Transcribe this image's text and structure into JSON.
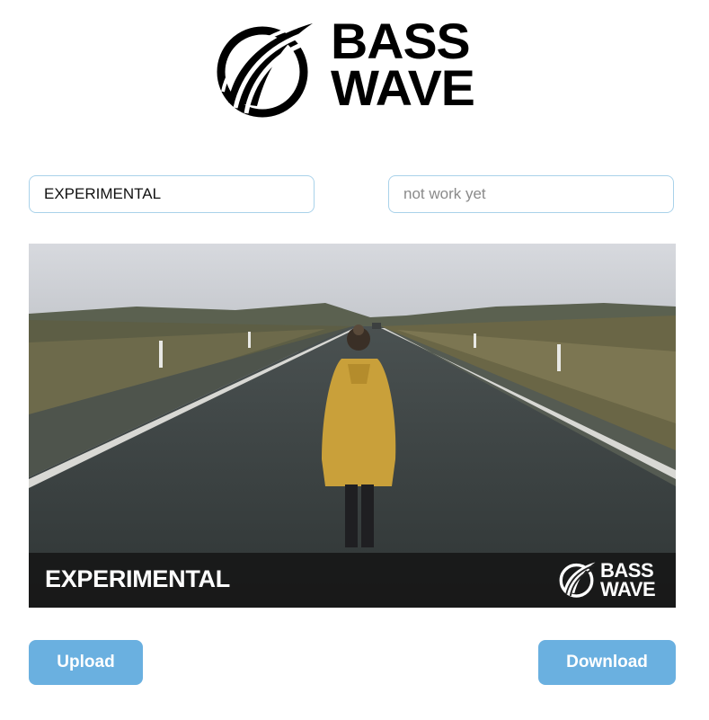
{
  "brand": {
    "line1": "BASS",
    "line2": "WAVE",
    "logo_icon": "basswave-logo-icon"
  },
  "inputs": {
    "title_value": "EXPERIMENTAL",
    "second_placeholder": "not work yet"
  },
  "preview": {
    "caption": "EXPERIMENTAL",
    "watermark_line1": "BASS",
    "watermark_line2": "WAVE",
    "caption_bar_color": "#161616"
  },
  "buttons": {
    "upload_label": "Upload",
    "download_label": "Download"
  },
  "colors": {
    "accent": "#6ab0e0",
    "input_border": "#a9d2ea"
  }
}
